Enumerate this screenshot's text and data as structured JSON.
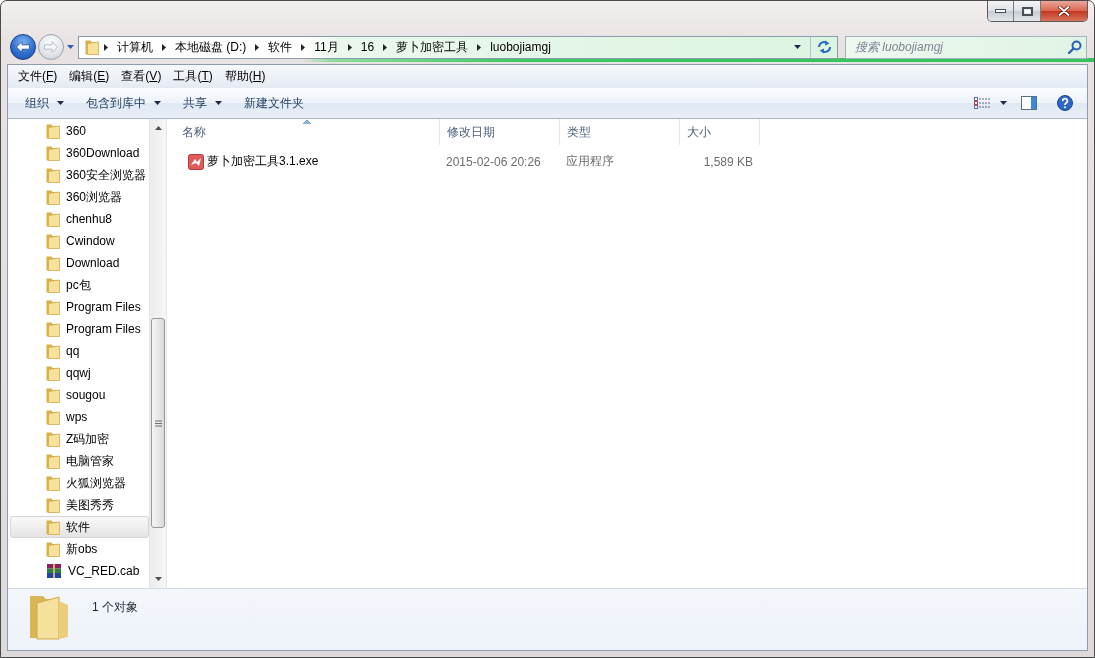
{
  "navigation": {
    "back": {
      "disabled": false
    },
    "forward": {
      "disabled": true
    }
  },
  "address_bar": {
    "segments": [
      "计算机",
      "本地磁盘 (D:)",
      "软件",
      "11月",
      "16",
      "萝卜加密工具",
      "luobojiamgj"
    ]
  },
  "search": {
    "placeholder": "搜索 luobojiamgj"
  },
  "menu_bar": [
    {
      "before": "文件(",
      "key": "F",
      "after": ")"
    },
    {
      "before": "编辑(",
      "key": "E",
      "after": ")"
    },
    {
      "before": "查看(",
      "key": "V",
      "after": ")"
    },
    {
      "before": "工具(",
      "key": "T",
      "after": ")"
    },
    {
      "before": "帮助(",
      "key": "H",
      "after": ")"
    }
  ],
  "command_bar": [
    {
      "label": "组织",
      "dropdown": true
    },
    {
      "label": "包含到库中",
      "dropdown": true
    },
    {
      "label": "共享",
      "dropdown": true
    },
    {
      "label": "新建文件夹",
      "dropdown": false
    }
  ],
  "sidebar": {
    "items": [
      {
        "label": "360",
        "kind": "folder",
        "selected": false
      },
      {
        "label": "360Download",
        "kind": "folder",
        "selected": false
      },
      {
        "label": "360安全浏览器",
        "kind": "folder",
        "selected": false
      },
      {
        "label": "360浏览器",
        "kind": "folder",
        "selected": false
      },
      {
        "label": "chenhu8",
        "kind": "folder",
        "selected": false
      },
      {
        "label": "Cwindow",
        "kind": "folder",
        "selected": false
      },
      {
        "label": "Download",
        "kind": "folder",
        "selected": false
      },
      {
        "label": "pc包",
        "kind": "folder",
        "selected": false
      },
      {
        "label": "Program Files",
        "kind": "folder",
        "selected": false
      },
      {
        "label": "Program Files",
        "kind": "folder",
        "selected": false
      },
      {
        "label": "qq",
        "kind": "folder",
        "selected": false
      },
      {
        "label": "qqwj",
        "kind": "folder",
        "selected": false
      },
      {
        "label": "sougou",
        "kind": "folder",
        "selected": false
      },
      {
        "label": "wps",
        "kind": "folder",
        "selected": false
      },
      {
        "label": "Z码加密",
        "kind": "folder",
        "selected": false
      },
      {
        "label": "电脑管家",
        "kind": "folder",
        "selected": false
      },
      {
        "label": "火狐浏览器",
        "kind": "folder",
        "selected": false
      },
      {
        "label": "美图秀秀",
        "kind": "folder",
        "selected": false
      },
      {
        "label": "软件",
        "kind": "folder",
        "selected": true
      },
      {
        "label": "新obs",
        "kind": "folder",
        "selected": false
      },
      {
        "label": "VC_RED.cab",
        "kind": "archive",
        "selected": false
      }
    ]
  },
  "table": {
    "columns": [
      {
        "label": "名称",
        "sorted": true
      },
      {
        "label": "修改日期",
        "sorted": false
      },
      {
        "label": "类型",
        "sorted": false
      },
      {
        "label": "大小",
        "sorted": false
      }
    ],
    "rows": [
      {
        "kind": "application",
        "cells": [
          "萝卜加密工具3.1.exe",
          "2015-02-06 20:26",
          "应用程序",
          "1,589 KB"
        ]
      }
    ]
  },
  "status_bar": {
    "text": "1 个对象"
  }
}
